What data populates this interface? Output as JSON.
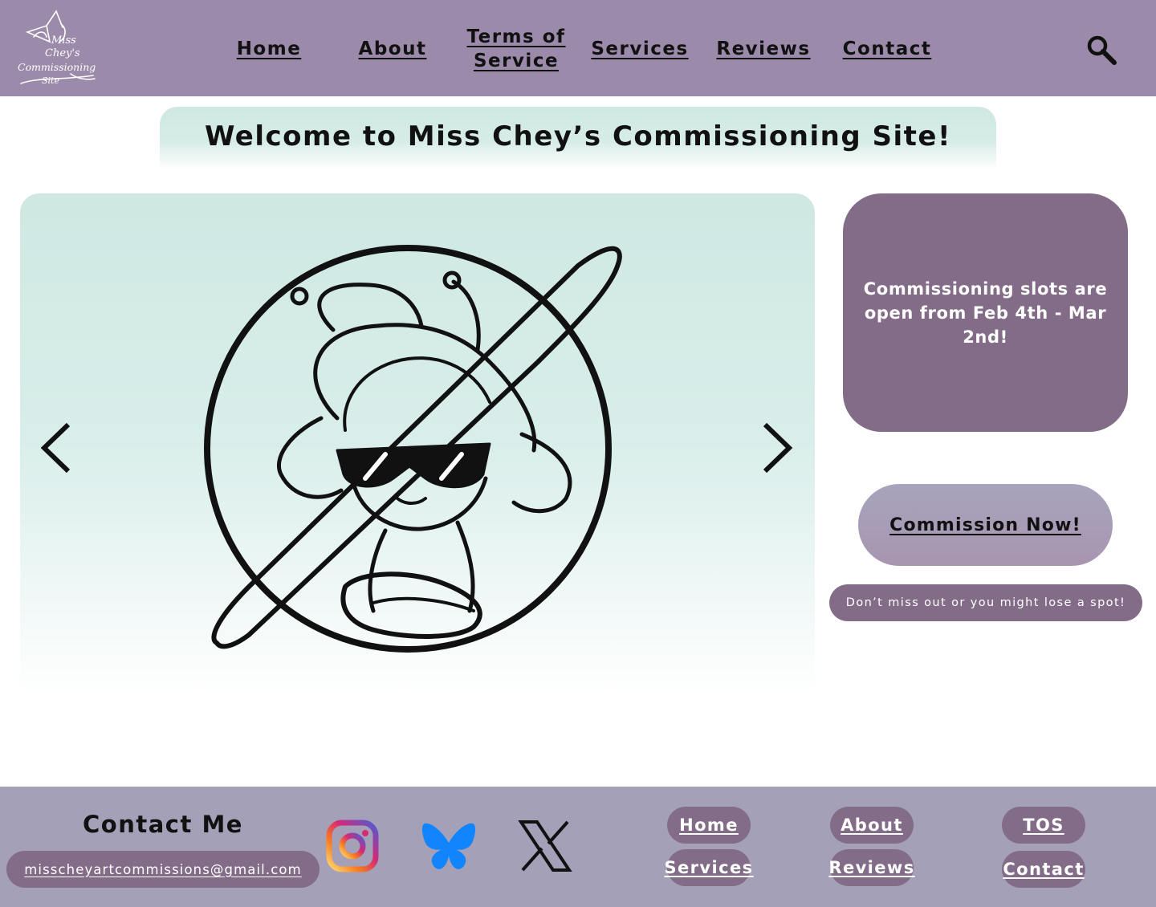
{
  "nav": {
    "items": [
      {
        "label": "Home"
      },
      {
        "label": "About"
      },
      {
        "label": "Terms of",
        "label2": "Service"
      },
      {
        "label": "Services"
      },
      {
        "label": "Reviews"
      },
      {
        "label": "Contact"
      }
    ]
  },
  "logo": {
    "lines": [
      "Miss",
      "Chey's",
      "Commissioning",
      "Site"
    ]
  },
  "welcome": {
    "title": "Welcome to Miss Chey’s Commissioning Site!"
  },
  "sidebar": {
    "slots_text": "Commissioning slots are open from Feb 4th - Mar 2nd!",
    "commission_button": "Commission Now!",
    "notice": "Don’t miss out or you might lose a spot!"
  },
  "footer": {
    "contact_title": "Contact Me",
    "email": "misscheyartcommissions@gmail.com",
    "links": {
      "home": "Home",
      "about": "About",
      "tos": "TOS",
      "services": "Services",
      "reviews": "Reviews",
      "contact": "Contact"
    }
  },
  "icons": {
    "search": "search-icon",
    "prev": "chevron-left-icon",
    "next": "chevron-right-icon",
    "instagram": "instagram-icon",
    "bluesky": "bluesky-butterfly-icon",
    "x": "x-logo-icon"
  },
  "colors": {
    "header_bg": "#9b8aaa",
    "accent_purple": "#836c88",
    "mint": "#cfe8e2",
    "footer_bg": "#a4a0b8",
    "bluesky_blue": "#1185fe"
  }
}
